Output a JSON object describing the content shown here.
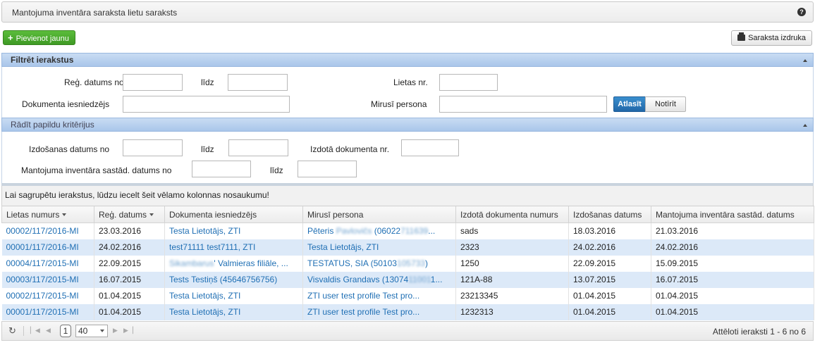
{
  "header": {
    "title": "Mantojuma inventāra saraksta lietu saraksts",
    "help_icon": "question-circle-icon"
  },
  "toolbar": {
    "add_label": "Pievienot jaunu",
    "print_label": "Saraksta izdruka"
  },
  "filter": {
    "title": "Filtrēt ierakstus",
    "reg_date_from_label": "Reģ. datums no",
    "reg_date_to_label": "līdz",
    "case_number_label": "Lietas nr.",
    "submitter_label": "Dokumenta iesniedzējs",
    "deceased_label": "Mirusī persona",
    "search_button": "Atlasīt",
    "clear_button": "Notīrīt"
  },
  "extra_filter": {
    "title": "Rādīt papildu kritērijus",
    "issue_date_from_label": "Izdošanas datums no",
    "issue_date_to_label": "līdz",
    "issued_doc_number_label": "Izdotā dokumenta nr.",
    "inventory_date_from_label": "Mantojuma inventāra sastād. datums no",
    "inventory_date_to_label": "līdz"
  },
  "grid": {
    "group_hint": "Lai sagrupētu ierakstus, lūdzu iecelt šeit vēlamo kolonnas nosaukumu!",
    "columns": [
      "Lietas numurs",
      "Reģ. datums",
      "Dokumenta iesniedzējs",
      "Mirusī persona",
      "Izdotā dokumenta numurs",
      "Izdošanas datums",
      "Mantojuma inventāra sastād. datums"
    ],
    "rows": [
      {
        "case": "00002/117/2016-MI",
        "reg": "23.03.2016",
        "sub_a": "Testa Lietotājs, ZTI",
        "sub_b": "",
        "dec_a": "Pēteris ",
        "dec_b": "Pavlovičs",
        "dec_c": " (06022",
        "dec_d": "711639",
        "dec_e": "...",
        "doc": "sads",
        "issue": "18.03.2016",
        "inv": "21.03.2016"
      },
      {
        "case": "00001/117/2016-MI",
        "reg": "24.02.2016",
        "sub_a": "test71111 test7111, ZTI",
        "sub_b": "",
        "dec_a": "Testa Lietotājs, ZTI",
        "dec_b": "",
        "dec_c": "",
        "dec_d": "",
        "dec_e": "",
        "doc": "2323",
        "issue": "24.02.2016",
        "inv": "24.02.2016"
      },
      {
        "case": "00004/117/2015-MI",
        "reg": "22.09.2015",
        "sub_a": "",
        "sub_b": "Sikambarus",
        "sub_c": "' Valmieras filiāle, ...",
        "dec_a": "TESTATUS, SIA (50103",
        "dec_b": "",
        "dec_c": "",
        "dec_d": "105733",
        "dec_e": ")",
        "doc": "1250",
        "issue": "22.09.2015",
        "inv": "15.09.2015"
      },
      {
        "case": "00003/117/2015-MI",
        "reg": "16.07.2015",
        "sub_a": "Tests Testiņš (45646756756)",
        "sub_b": "",
        "dec_a": "Visvaldis Grandavs (13074",
        "dec_b": "",
        "dec_c": "",
        "dec_d": "11001",
        "dec_e": "1...",
        "doc": "121A-88",
        "issue": "13.07.2015",
        "inv": "16.07.2015"
      },
      {
        "case": "00002/117/2015-MI",
        "reg": "01.04.2015",
        "sub_a": "Testa Lietotājs, ZTI",
        "sub_b": "",
        "dec_a": "ZTI user test profile Test pro...",
        "dec_b": "",
        "dec_c": "",
        "dec_d": "",
        "dec_e": "",
        "doc": "23213345",
        "issue": "01.04.2015",
        "inv": "01.04.2015"
      },
      {
        "case": "00001/117/2015-MI",
        "reg": "01.04.2015",
        "sub_a": "Testa Lietotājs, ZTI",
        "sub_b": "",
        "dec_a": "ZTI user test profile Test pro...",
        "dec_b": "",
        "dec_c": "",
        "dec_d": "",
        "dec_e": "",
        "doc": "1232313",
        "issue": "01.04.2015",
        "inv": "01.04.2015"
      }
    ]
  },
  "pager": {
    "page": "1",
    "page_size": "40",
    "info": "Attēloti ieraksti 1 - 6 no 6"
  }
}
